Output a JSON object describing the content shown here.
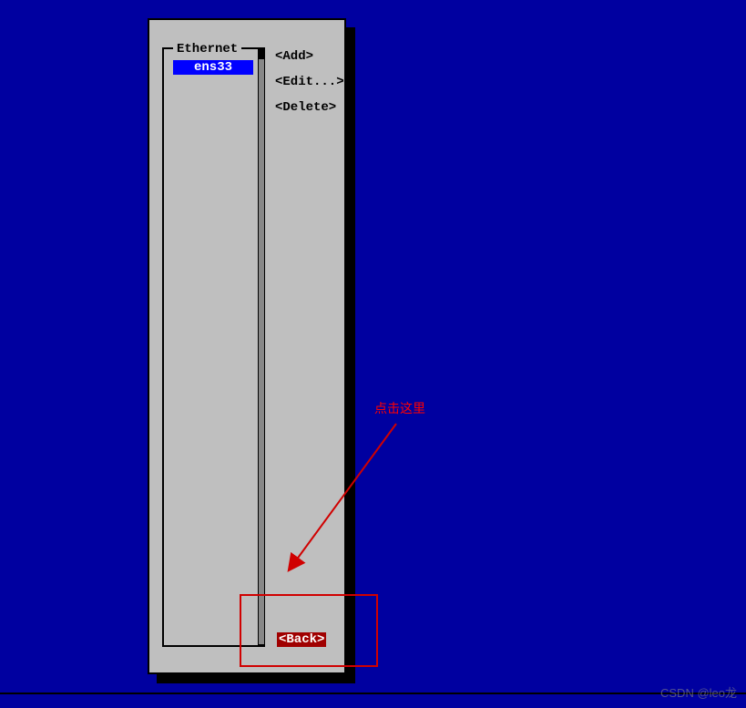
{
  "dialog": {
    "list_header": "Ethernet",
    "selected_item": "ens33",
    "actions": {
      "add": "<Add>",
      "edit": "<Edit...>",
      "delete": "<Delete>"
    },
    "back": "<Back>"
  },
  "annotation": {
    "text": "点击这里"
  },
  "watermark": "CSDN @leo龙"
}
